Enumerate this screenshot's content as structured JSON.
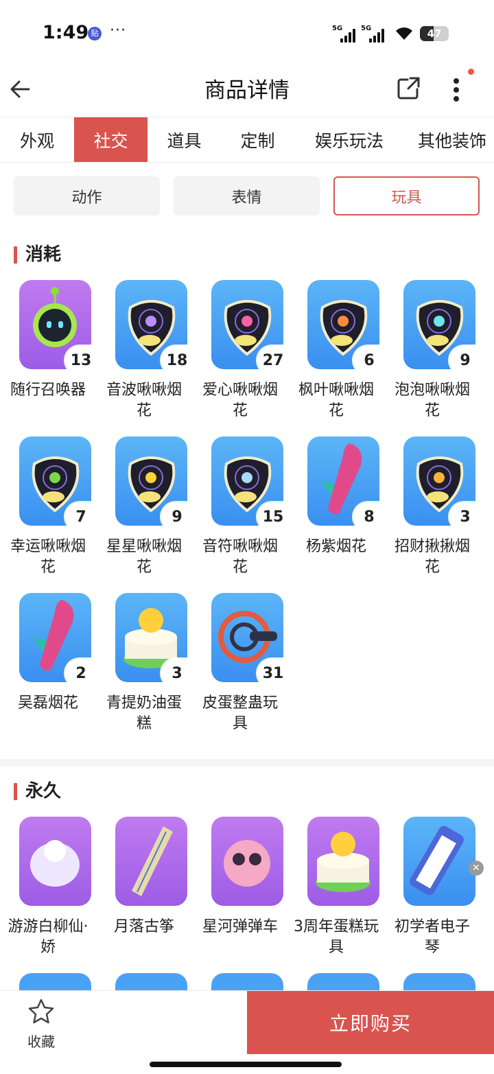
{
  "status_bar": {
    "time": "1:49",
    "app_badge": "贴",
    "dots": "···",
    "net1": "5G",
    "net2": "5G",
    "battery": "47",
    "battery_level": 0.47
  },
  "header": {
    "title": "商品详情"
  },
  "tabs": [
    {
      "label": "外观",
      "active": false
    },
    {
      "label": "社交",
      "active": true
    },
    {
      "label": "道具",
      "active": false
    },
    {
      "label": "定制",
      "active": false
    },
    {
      "label": "娱乐玩法",
      "active": false
    },
    {
      "label": "其他装饰",
      "active": false
    }
  ],
  "subtabs": [
    {
      "label": "动作",
      "active": false
    },
    {
      "label": "表情",
      "active": false
    },
    {
      "label": "玩具",
      "active": true
    }
  ],
  "sections": {
    "consumable": {
      "title": "消耗",
      "items": [
        {
          "name": "随行召唤器",
          "count": "13",
          "bg": "purple",
          "icon": "robot-icon"
        },
        {
          "name": "音波啾啾烟花",
          "count": "18",
          "bg": "blue",
          "icon": "firework-soundwave-icon"
        },
        {
          "name": "爱心啾啾烟花",
          "count": "27",
          "bg": "blue",
          "icon": "firework-heart-icon"
        },
        {
          "name": "枫叶啾啾烟花",
          "count": "6",
          "bg": "blue",
          "icon": "firework-maple-icon"
        },
        {
          "name": "泡泡啾啾烟花",
          "count": "9",
          "bg": "blue",
          "icon": "firework-bubble-icon"
        },
        {
          "name": "幸运啾啾烟花",
          "count": "7",
          "bg": "blue",
          "icon": "firework-clover-icon"
        },
        {
          "name": "星星啾啾烟花",
          "count": "9",
          "bg": "blue",
          "icon": "firework-star-icon"
        },
        {
          "name": "音符啾啾烟花",
          "count": "15",
          "bg": "blue",
          "icon": "firework-note-icon"
        },
        {
          "name": "杨紫烟花",
          "count": "8",
          "bg": "blue",
          "icon": "rocket-firework-icon"
        },
        {
          "name": "招财揪揪烟花",
          "count": "3",
          "bg": "blue",
          "icon": "firework-fortune-icon"
        },
        {
          "name": "吴磊烟花",
          "count": "2",
          "bg": "blue",
          "icon": "rocket-firework-icon"
        },
        {
          "name": "青提奶油蛋糕",
          "count": "3",
          "bg": "blue",
          "icon": "cake-icon"
        },
        {
          "name": "皮蛋整蛊玩具",
          "count": "31",
          "bg": "blue",
          "icon": "prank-toy-icon"
        }
      ]
    },
    "permanent": {
      "title": "永久",
      "items": [
        {
          "name": "游游白柳仙·娇",
          "bg": "purple",
          "icon": "spirit-creature-icon"
        },
        {
          "name": "月落古筝",
          "bg": "purple",
          "icon": "guzheng-icon"
        },
        {
          "name": "星河弹弹车",
          "bg": "purple",
          "icon": "bumper-car-icon"
        },
        {
          "name": "3周年蛋糕玩具",
          "bg": "purple",
          "icon": "anniversary-cake-icon"
        },
        {
          "name": "初学者电子琴",
          "bg": "blue",
          "icon": "keyboard-icon"
        }
      ]
    }
  },
  "bottom_bar": {
    "favorite_label": "收藏",
    "buy_label": "立即购买"
  },
  "colors": {
    "accent": "#d9534f",
    "tile_blue": "#4aa2f4",
    "tile_purple": "#ae6ceb"
  }
}
